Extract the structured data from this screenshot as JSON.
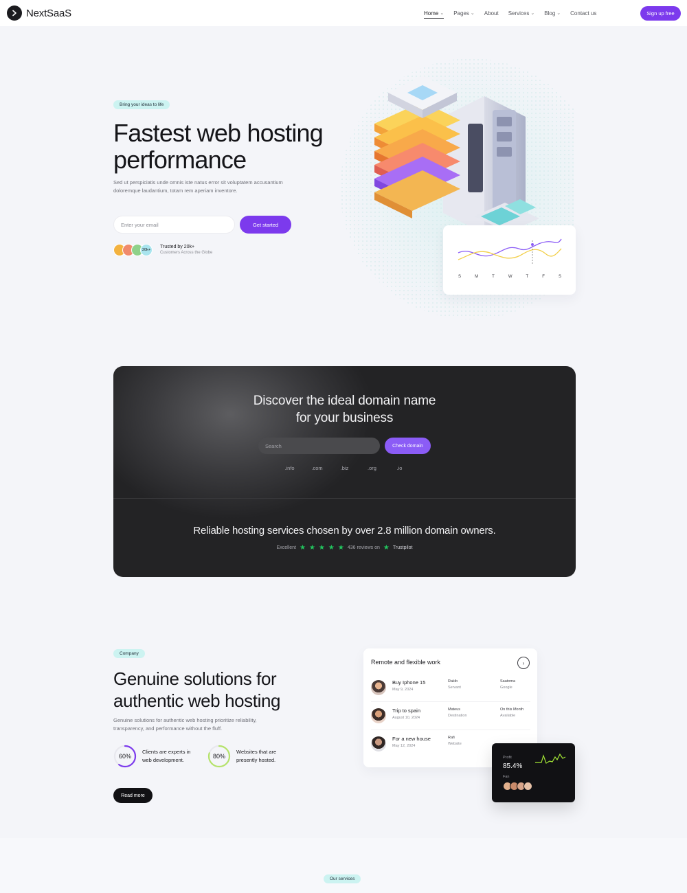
{
  "nav": {
    "logo_text": "NextSaaS",
    "links": [
      {
        "label": "Home",
        "caret": true
      },
      {
        "label": "Pages",
        "caret": true
      },
      {
        "label": "About",
        "caret": false
      },
      {
        "label": "Services",
        "caret": true
      },
      {
        "label": "Blog",
        "caret": true
      },
      {
        "label": "Contact us",
        "caret": false
      }
    ],
    "signup_label": "Sign up free"
  },
  "hero": {
    "badge": "Bring your ideas to life",
    "title": "Fastest web hosting performance",
    "description": "Sed ut perspiciatis unde omnis iste natus error sit voluptatem accusantium doloremque laudantium, totam rem aperiam inventore.",
    "email_placeholder": "Enter your email",
    "cta_label": "Get started",
    "avatar_more": "20k+",
    "trusted_title": "Trusted by 20k+",
    "trusted_sub": "Customers Across the Globe",
    "chart_days": [
      "S",
      "M",
      "T",
      "W",
      "T",
      "F",
      "S"
    ]
  },
  "domain": {
    "title_line1": "Discover the ideal domain name",
    "title_line2": "for your business",
    "search_placeholder": "Search",
    "check_label": "Check domain",
    "tlds": [
      ".info",
      ".com",
      ".biz",
      ".org",
      ".io"
    ],
    "tagline": "Reliable hosting services chosen by over 2.8 million domain owners.",
    "rating_label": "Excellent",
    "reviews": "436 reviews on",
    "trustpilot": "Trustpilot",
    "star_color": "#22c55e"
  },
  "solutions": {
    "badge": "Company",
    "title": "Genuine solutions for authentic web hosting",
    "description": "Genuine solutions for authentic web hosting prioritize reliability, transparency, and performance without the fluff.",
    "stats": [
      {
        "value": "60%",
        "text": "Clients are experts in web development.",
        "color": "#7c3aed"
      },
      {
        "value": "80%",
        "text": "Websites that are presently hosted.",
        "color": "#b5e36a"
      }
    ],
    "read_more": "Read more"
  },
  "work_card": {
    "title": "Remote and flexible work",
    "rows": [
      {
        "title": "Buy Iphone 15",
        "date": "May 9, 2024",
        "col2a": "Rakib",
        "col2b": "Servant",
        "col3a": "Saatoma",
        "col3b": "Google"
      },
      {
        "title": "Trip to spain",
        "date": "August 10, 2024",
        "col2a": "Mateus",
        "col2b": "Destination",
        "col3a": "On this Month",
        "col3b": "Available"
      },
      {
        "title": "For a new house",
        "date": "May 12, 2024",
        "col2a": "Rafi",
        "col2b": "Website",
        "col3a": "",
        "col3b": ""
      }
    ]
  },
  "profit_card": {
    "label": "Profit",
    "value": "85.4%",
    "fan_label": "Fan"
  },
  "services": {
    "badge": "Our services"
  },
  "colors": {
    "accent": "#7c3aed",
    "badge_bg": "#ccf3f1",
    "dark_card": "#232325"
  }
}
